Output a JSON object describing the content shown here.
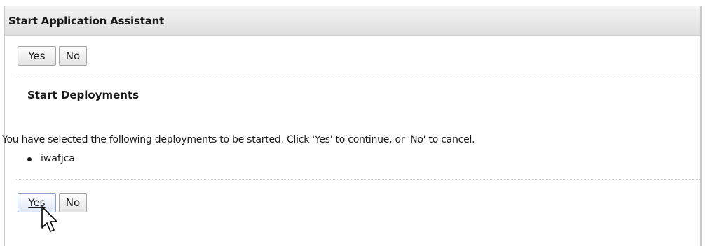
{
  "dialog": {
    "title": "Start Application Assistant"
  },
  "top_buttons": {
    "yes_label": "Yes",
    "no_label": "No"
  },
  "section": {
    "title": "Start Deployments",
    "message": "You have selected the following deployments to be started. Click 'Yes' to continue, or 'No' to cancel.",
    "deployments": [
      "iwafjca"
    ]
  },
  "bottom_buttons": {
    "yes_label": "Yes",
    "no_label": "No"
  },
  "colors": {
    "title_bar": "#e8e8e8",
    "text": "#1a1a1a",
    "button_border": "#a5a5a5",
    "button_hover_border": "#8aa2c6"
  },
  "icons": {
    "cursor": "mouse-pointer-icon",
    "bullet": "bullet-icon"
  }
}
